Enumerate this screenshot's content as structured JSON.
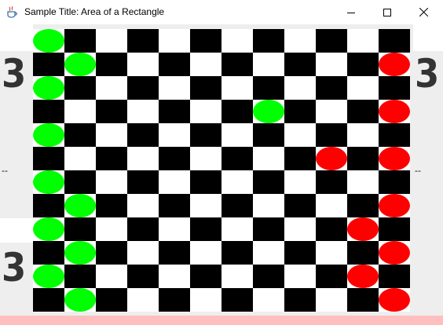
{
  "window": {
    "title": "Sample Title: Area of a Rectangle",
    "icon": "java-cup-icon",
    "controls": [
      "minimize",
      "maximize",
      "close"
    ]
  },
  "scores": {
    "left_top": "3",
    "left_bottom": "3",
    "right_top": "3",
    "left_separator": "--",
    "right_separator": "--"
  },
  "board": {
    "rows": 12,
    "cols": 12,
    "dark_color": "#000000",
    "light_color": "#ffffff",
    "first_cell": "light",
    "player_colors": {
      "green": "#00ff00",
      "red": "#ff0000"
    },
    "pieces": [
      {
        "row": 0,
        "col": 0,
        "color": "green"
      },
      {
        "row": 2,
        "col": 0,
        "color": "green"
      },
      {
        "row": 4,
        "col": 0,
        "color": "green"
      },
      {
        "row": 6,
        "col": 0,
        "color": "green"
      },
      {
        "row": 8,
        "col": 0,
        "color": "green"
      },
      {
        "row": 10,
        "col": 0,
        "color": "green"
      },
      {
        "row": 1,
        "col": 1,
        "color": "green"
      },
      {
        "row": 7,
        "col": 1,
        "color": "green"
      },
      {
        "row": 9,
        "col": 1,
        "color": "green"
      },
      {
        "row": 11,
        "col": 1,
        "color": "green"
      },
      {
        "row": 3,
        "col": 7,
        "color": "green"
      },
      {
        "row": 5,
        "col": 9,
        "color": "red"
      },
      {
        "row": 8,
        "col": 10,
        "color": "red"
      },
      {
        "row": 10,
        "col": 10,
        "color": "red"
      },
      {
        "row": 1,
        "col": 11,
        "color": "red"
      },
      {
        "row": 3,
        "col": 11,
        "color": "red"
      },
      {
        "row": 5,
        "col": 11,
        "color": "red"
      },
      {
        "row": 7,
        "col": 11,
        "color": "red"
      },
      {
        "row": 9,
        "col": 11,
        "color": "red"
      },
      {
        "row": 11,
        "col": 11,
        "color": "red"
      }
    ]
  }
}
